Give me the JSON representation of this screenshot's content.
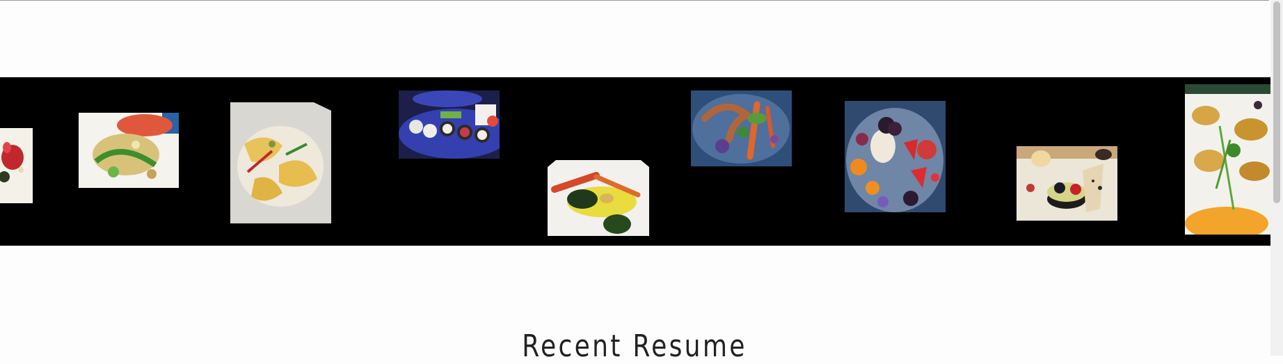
{
  "gallery": {
    "photos": [
      {
        "subject": "strawberry-dessert-plate"
      },
      {
        "subject": "seafood-salad-plate"
      },
      {
        "subject": "ravioli-plate"
      },
      {
        "subject": "sushi-platter"
      },
      {
        "subject": "roasted-carrots-plate"
      },
      {
        "subject": "grilled-octopus-plate"
      },
      {
        "subject": "berry-dessert-plate"
      },
      {
        "subject": "tart-dessert-plate"
      },
      {
        "subject": "seared-scallops-plate"
      }
    ]
  },
  "section": {
    "title": "Recent Resume"
  },
  "colors": {
    "strip_bg": "#000000",
    "page_bg": "#fdfdfd",
    "title_text": "#222222"
  }
}
